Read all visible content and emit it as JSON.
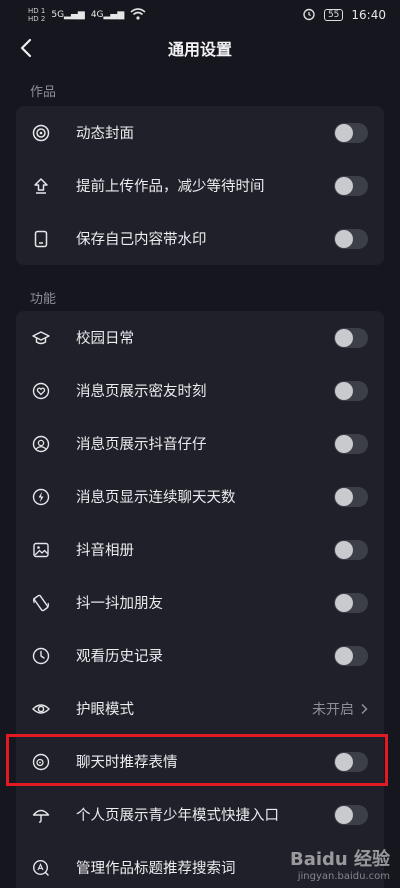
{
  "status_bar": {
    "hd1": "HD 1",
    "hd2": "HD 2",
    "signal1": "5G",
    "signal2": "4G",
    "battery": "55",
    "time": "16:40"
  },
  "header": {
    "title": "通用设置"
  },
  "sections": [
    {
      "title": "作品",
      "items": [
        {
          "label": "动态封面",
          "icon": "dynamic-cover-icon"
        },
        {
          "label": "提前上传作品，减少等待时间",
          "icon": "upload-icon"
        },
        {
          "label": "保存自己内容带水印",
          "icon": "watermark-icon"
        }
      ]
    },
    {
      "title": "功能",
      "items": [
        {
          "label": "校园日常",
          "icon": "campus-icon"
        },
        {
          "label": "消息页展示密友时刻",
          "icon": "heart-circle-icon"
        },
        {
          "label": "消息页展示抖音仔仔",
          "icon": "avatar-circle-icon"
        },
        {
          "label": "消息页显示连续聊天天数",
          "icon": "flash-icon"
        },
        {
          "label": "抖音相册",
          "icon": "album-icon"
        },
        {
          "label": "抖一抖加朋友",
          "icon": "shake-phone-icon"
        },
        {
          "label": "观看历史记录",
          "icon": "clock-icon"
        },
        {
          "label": "护眼模式",
          "icon": "eye-icon",
          "value": "未开启"
        },
        {
          "label": "聊天时推荐表情",
          "icon": "sticker-icon"
        },
        {
          "label": "个人页展示青少年模式快捷入口",
          "icon": "umbrella-icon"
        },
        {
          "label": "管理作品标题推荐搜索词",
          "icon": "search-a-icon"
        }
      ]
    }
  ],
  "watermark": {
    "brand": "Baidu 经验",
    "url": "jingyan.baidu.com"
  }
}
